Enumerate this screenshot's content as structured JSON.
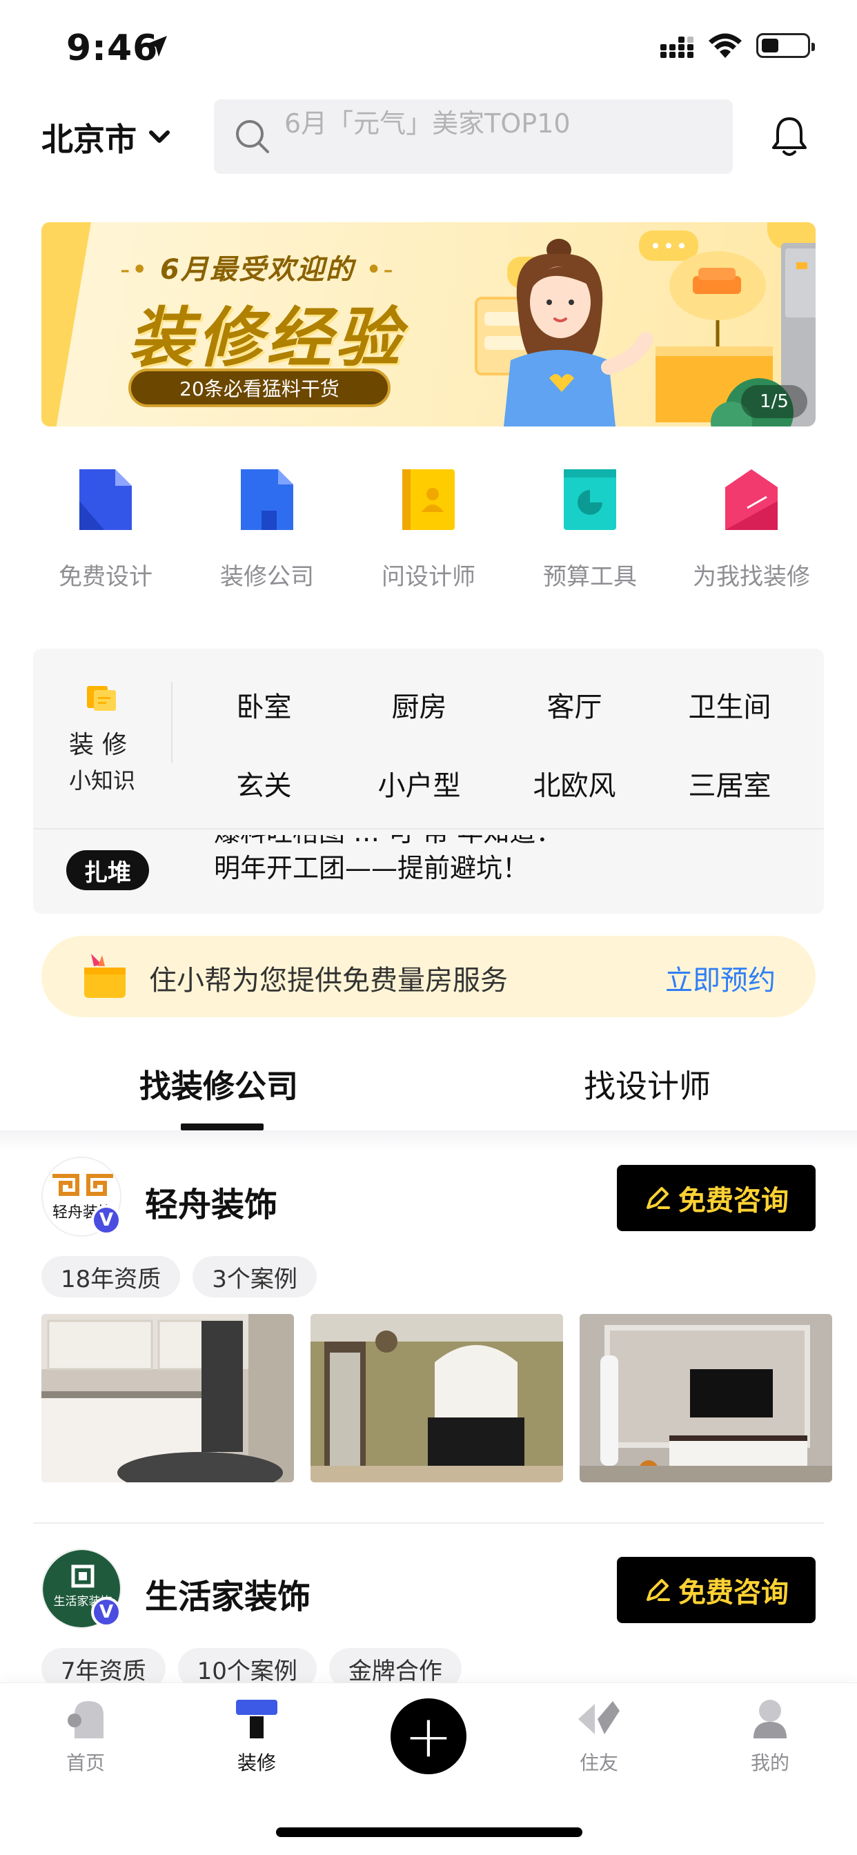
{
  "status_bar": {
    "time": "9:46"
  },
  "header": {
    "city": "北京市",
    "search_placeholder": "6月「元气」美家TOP10"
  },
  "banner": {
    "subtitle": "6月最受欢迎的",
    "title": "装修经验",
    "pill": "20条必看猛料干货",
    "page_indicator": "1/5"
  },
  "quick_links": [
    {
      "label": "免费设计",
      "icon": "document-icon",
      "color": "#3355e8"
    },
    {
      "label": "装修公司",
      "icon": "building-icon",
      "color": "#2f6df0"
    },
    {
      "label": "问设计师",
      "icon": "designer-card-icon",
      "color": "#ffcc00"
    },
    {
      "label": "预算工具",
      "icon": "budget-chart-icon",
      "color": "#19d0c8"
    },
    {
      "label": "为我找装修",
      "icon": "house-ruler-icon",
      "color": "#f23a6e"
    }
  ],
  "knowledge": {
    "title_line1": "装修",
    "title_line2": "小知识",
    "tags": [
      "卧室",
      "厨房",
      "客厅",
      "卫生间",
      "玄关",
      "小户型",
      "北欧风",
      "三居室"
    ],
    "badge": "扎堆",
    "ticker_line1": "爆料旺格图 … 可 帮 年知道：",
    "ticker_line2": "明年开工团——提前避坑！"
  },
  "promo": {
    "text": "住小帮为您提供免费量房服务",
    "cta": "立即预约"
  },
  "tabs": [
    {
      "label": "找装修公司",
      "active": true
    },
    {
      "label": "找设计师",
      "active": false
    }
  ],
  "companies": [
    {
      "name": "轻舟装饰",
      "logo_text": "轻舟装饰",
      "consult_label": "免费咨询",
      "tags": [
        "18年资质",
        "3个案例"
      ]
    },
    {
      "name": "生活家装饰",
      "logo_text": "生活家装饰",
      "consult_label": "免费咨询",
      "tags": [
        "7年资质",
        "10个案例",
        "金牌合作"
      ]
    }
  ],
  "bottom_nav": [
    {
      "label": "首页",
      "icon": "home-icon"
    },
    {
      "label": "装修",
      "icon": "paint-roller-icon",
      "active": true
    },
    {
      "label": "",
      "icon": "plus-icon"
    },
    {
      "label": "住友",
      "icon": "friends-icon"
    },
    {
      "label": "我的",
      "icon": "profile-icon"
    }
  ],
  "colors": {
    "accent": "#ffd234",
    "link": "#2f7ef6",
    "banner_bg": "#fff2c8",
    "verified": "#4b4de0"
  }
}
